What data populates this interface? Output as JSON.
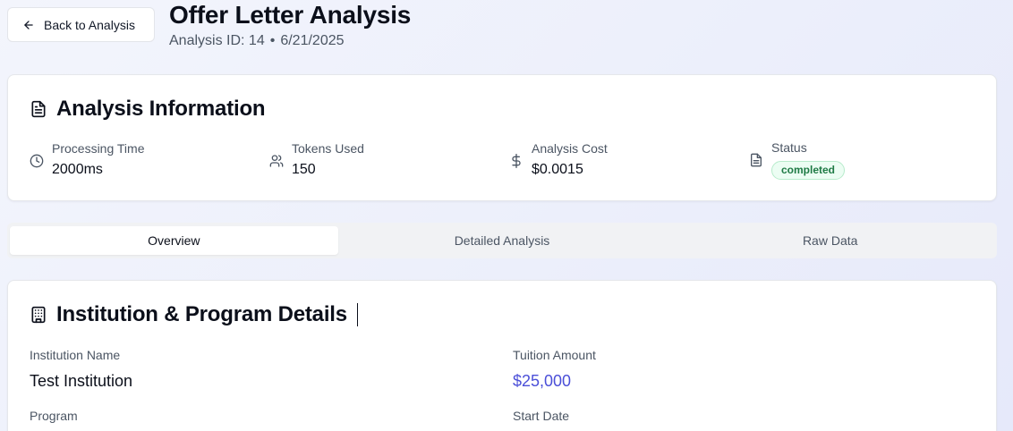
{
  "header": {
    "back_label": "Back to Analysis",
    "title": "Offer Letter Analysis",
    "analysis_id": "Analysis ID: 14",
    "separator": "•",
    "date": "6/21/2025"
  },
  "info_card": {
    "title": "Analysis Information",
    "stats": [
      {
        "label": "Processing Time",
        "value": "2000ms",
        "icon": "clock-icon"
      },
      {
        "label": "Tokens Used",
        "value": "150",
        "icon": "users-icon"
      },
      {
        "label": "Analysis Cost",
        "value": "$0.0015",
        "icon": "dollar-icon"
      },
      {
        "label": "Status",
        "value": "completed",
        "icon": "document-icon"
      }
    ]
  },
  "tabs": [
    {
      "label": "Overview",
      "active": true
    },
    {
      "label": "Detailed Analysis",
      "active": false
    },
    {
      "label": "Raw Data",
      "active": false
    }
  ],
  "details_card": {
    "title": "Institution & Program Details",
    "fields": [
      {
        "label": "Institution Name",
        "value": "Test Institution"
      },
      {
        "label": "Tuition Amount",
        "value": "$25,000"
      },
      {
        "label": "Program",
        "value": ""
      },
      {
        "label": "Start Date",
        "value": ""
      }
    ]
  },
  "colors": {
    "accent_money": "#4b4fd8",
    "status_bg": "#ecfdf3",
    "status_text": "#1f7a45"
  }
}
